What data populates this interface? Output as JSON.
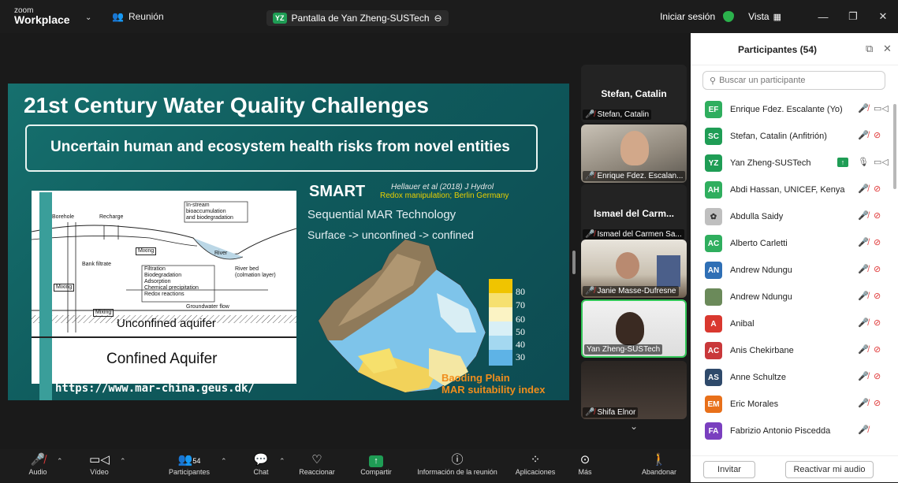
{
  "topbar": {
    "brand_small": "zoom",
    "brand": "Workplace",
    "meeting_label": "Reunión",
    "share_badge": "YZ",
    "share_title": "Pantalla de Yan Zheng-SUSTech",
    "signin": "Iniciar sesión",
    "view": "Vista"
  },
  "slide": {
    "title": "21st Century Water Quality Challenges",
    "subtitle": "Uncertain human and ecosystem health risks from novel entities",
    "smart": "SMART",
    "citation": "Hellauer et al (2018) J Hydrol",
    "redox": "Redox manipulation; Berlin Germany",
    "sequential": "Sequential MAR Technology",
    "surface": "Surface -> unconfined -> confined",
    "unconfined": "Unconfined aquifer",
    "confined": "Confined Aquifer",
    "url": "https://www.mar-china.geus.dk/",
    "map_title_1": "Baoding Plain",
    "map_title_2": "MAR suitability index",
    "legend_values": [
      "80",
      "70",
      "60",
      "50",
      "40",
      "30"
    ],
    "diagram_labels": {
      "borehole": "Borehole",
      "recharge": "Recharge",
      "instream_1": "In-stream",
      "instream_2": "bioaccumulation",
      "instream_3": "and biodegradation",
      "mixing": "Mixing",
      "river": "River",
      "bank": "Bank filtrate",
      "proc_1": "Filtration",
      "proc_2": "Biodegradation",
      "proc_3": "Adsorption",
      "proc_4": "Chemical precipitation",
      "proc_5": "Redox reactions",
      "riverbed_1": "River bed",
      "riverbed_2": "(colmation layer)",
      "gwflow": "Groundwater flow"
    }
  },
  "gallery": {
    "tiles": [
      {
        "name": "Stefan, Catalin",
        "label": "Stefan, Catalin"
      },
      {
        "name": "",
        "label": "Enrique Fdez. Escalan..."
      },
      {
        "name": "Ismael del Carm...",
        "label": "Ismael del Carmen Sa..."
      },
      {
        "name": "",
        "label": "Janie Masse-Dufresne"
      },
      {
        "name": "",
        "label": "Yan Zheng-SUSTech"
      },
      {
        "name": "",
        "label": "Shifa Elnor"
      }
    ]
  },
  "participants": {
    "title": "Participantes (54)",
    "search_placeholder": "Buscar un participante",
    "list": [
      {
        "initials": "EF",
        "name": "Enrique Fdez. Escalante (Yo)",
        "color": "#2fae5e"
      },
      {
        "initials": "SC",
        "name": "Stefan, Catalin (Anfitrión)",
        "color": "#1f9d55"
      },
      {
        "initials": "YZ",
        "name": "Yan Zheng-SUSTech",
        "color": "#1f9d55"
      },
      {
        "initials": "AH",
        "name": "Abdi Hassan, UNICEF, Kenya",
        "color": "#2fae5e"
      },
      {
        "initials": "",
        "name": "Abdulla Saidy",
        "color": "#bfbfbf"
      },
      {
        "initials": "AC",
        "name": "Alberto Carletti",
        "color": "#2fae5e"
      },
      {
        "initials": "AN",
        "name": "Andrew Ndungu",
        "color": "#2f6fb5"
      },
      {
        "initials": "",
        "name": "Andrew Ndungu",
        "color": "#6b8a5a"
      },
      {
        "initials": "A",
        "name": "Anibal",
        "color": "#d9382f"
      },
      {
        "initials": "AC",
        "name": "Anis Chekirbane",
        "color": "#c9383a"
      },
      {
        "initials": "AS",
        "name": "Anne Schultze",
        "color": "#2f4a6b"
      },
      {
        "initials": "EM",
        "name": "Eric Morales",
        "color": "#e8701a"
      },
      {
        "initials": "FA",
        "name": "Fabrizio Antonio Piscedda",
        "color": "#7a3fbf"
      }
    ],
    "invite": "Invitar",
    "unmute": "Reactivar mi audio"
  },
  "toolbar": {
    "audio": "Audio",
    "video": "Vídeo",
    "participants": "Participantes",
    "participants_count": "54",
    "chat": "Chat",
    "react": "Reaccionar",
    "share": "Compartir",
    "info": "Información de la reunión",
    "apps": "Aplicaciones",
    "more": "Más",
    "leave": "Abandonar"
  }
}
